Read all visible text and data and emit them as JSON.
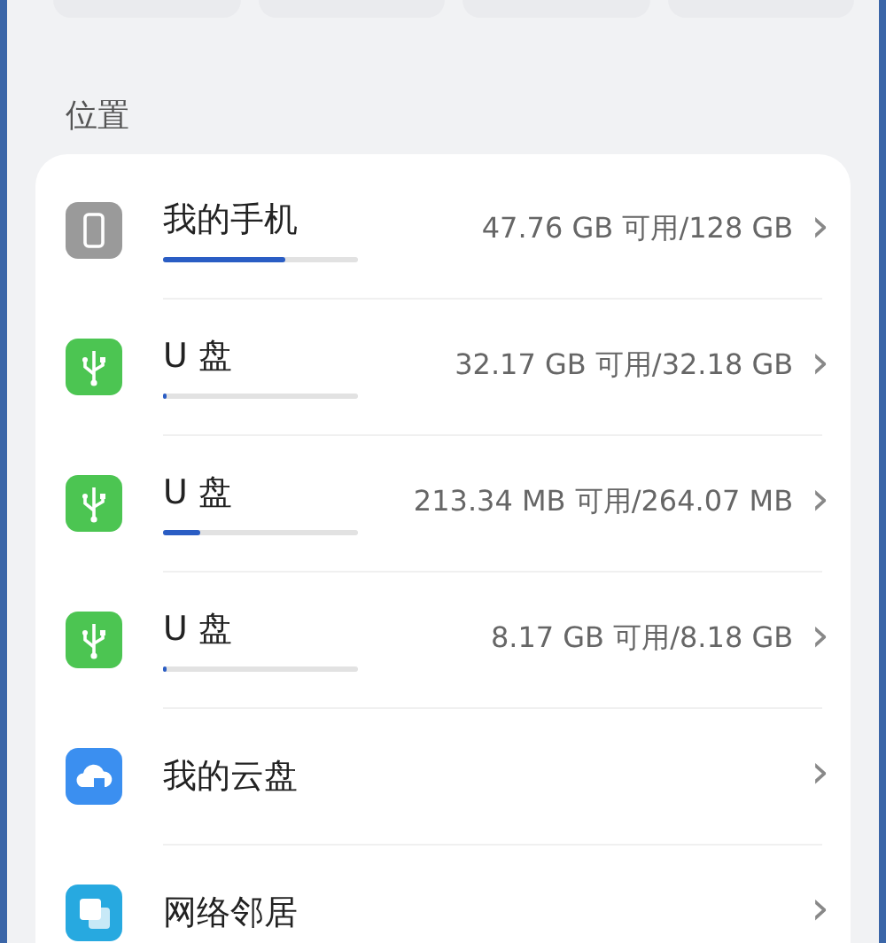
{
  "section_title": "位置",
  "locations": [
    {
      "kind": "phone",
      "name": "我的手机",
      "level": 0.63,
      "reading": "47.76 GB 可用/128 GB",
      "chevron": "›"
    },
    {
      "kind": "usb",
      "name": "U 盘",
      "level": 0.01,
      "reading": "32.17 GB 可用/32.18 GB",
      "chevron": "›"
    },
    {
      "kind": "usb",
      "name": "U 盘",
      "level": 0.19,
      "reading": "213.34 MB 可用/264.07 MB",
      "chevron": "›"
    },
    {
      "kind": "usb",
      "name": "U 盘",
      "level": 0.01,
      "reading": "8.17 GB 可用/8.18 GB",
      "chevron": "›"
    },
    {
      "kind": "cloud",
      "name": "我的云盘",
      "chevron": "›"
    },
    {
      "kind": "network",
      "name": "网络邻居",
      "chevron": "›"
    }
  ]
}
